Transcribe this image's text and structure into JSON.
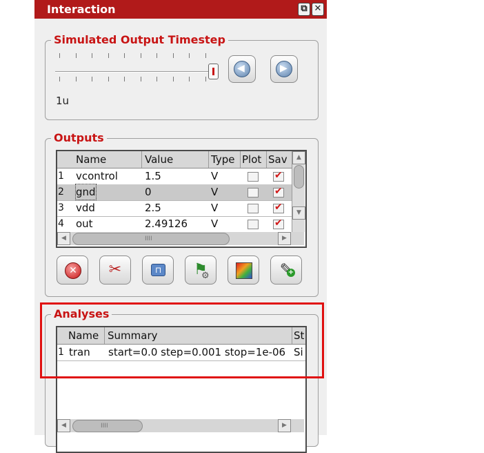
{
  "panel": {
    "title": "Interaction",
    "float_icon": "restore-window-icon",
    "close_icon": "close-icon"
  },
  "timestep": {
    "legend": "Simulated Output Timestep",
    "value": "1u",
    "slider_position": 1.0,
    "prev_icon": "circle-arrow-left-icon",
    "next_icon": "circle-arrow-right-icon"
  },
  "outputs": {
    "legend": "Outputs",
    "columns": [
      "Name",
      "Value",
      "Type",
      "Plot",
      "Sav"
    ],
    "rows": [
      {
        "num": "1",
        "name": "vcontrol",
        "value": "1.5",
        "type": "V",
        "plot": false,
        "save": true,
        "selected": false
      },
      {
        "num": "2",
        "name": "gnd",
        "value": "0",
        "type": "V",
        "plot": false,
        "save": true,
        "selected": true
      },
      {
        "num": "3",
        "name": "vdd",
        "value": "2.5",
        "type": "V",
        "plot": false,
        "save": true,
        "selected": false
      },
      {
        "num": "4",
        "name": "out",
        "value": "2.49126",
        "type": "V",
        "plot": false,
        "save": true,
        "selected": false
      }
    ],
    "tools": [
      "delete-icon",
      "scissors-icon",
      "wave-icon",
      "flag-gear-icon",
      "spectrum-icon",
      "probe-add-icon"
    ]
  },
  "analyses": {
    "legend": "Analyses",
    "columns": [
      "Name",
      "Summary",
      "St"
    ],
    "rows": [
      {
        "num": "1",
        "name": "tran",
        "summary": "start=0.0 step=0.001 stop=1e-06",
        "status": "Si"
      }
    ]
  },
  "colors": {
    "title_bar": "#b11a1a",
    "legend_text": "#c81414",
    "highlight_box": "#e01010"
  }
}
